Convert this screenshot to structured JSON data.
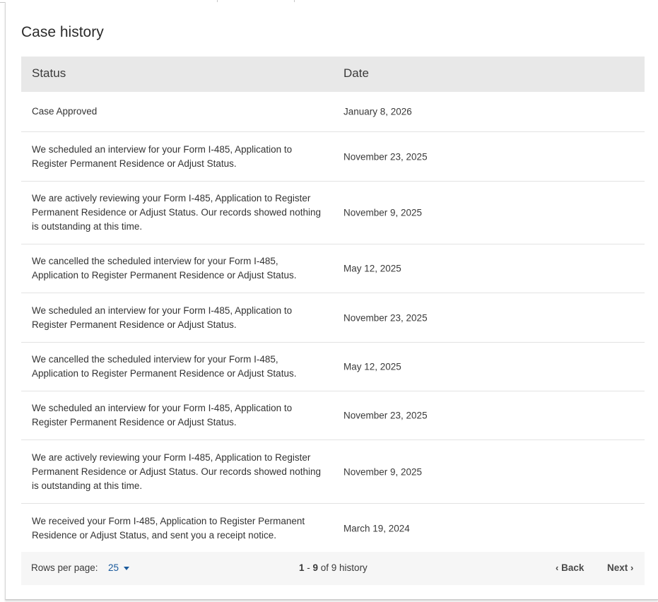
{
  "card": {
    "title": "Case history"
  },
  "table": {
    "headers": {
      "status": "Status",
      "date": "Date"
    },
    "rows": [
      {
        "status": "Case Approved",
        "date": "January 8, 2026"
      },
      {
        "status": "We scheduled an interview for your Form I-485, Application to Register Permanent Residence or Adjust Status.",
        "date": "November 23, 2025"
      },
      {
        "status": "We are actively reviewing your Form I-485, Application to Register Permanent Residence or Adjust Status. Our records showed nothing is outstanding at this time.",
        "date": "November 9, 2025"
      },
      {
        "status": "We cancelled the scheduled interview for your Form I-485, Application to Register Permanent Residence or Adjust Status.",
        "date": "May 12, 2025"
      },
      {
        "status": "We scheduled an interview for your Form I-485, Application to Register Permanent Residence or Adjust Status.",
        "date": "November 23, 2025"
      },
      {
        "status": "We cancelled the scheduled interview for your Form I-485, Application to Register Permanent Residence or Adjust Status.",
        "date": "May 12, 2025"
      },
      {
        "status": "We scheduled an interview for your Form I-485, Application to Register Permanent Residence or Adjust Status.",
        "date": "November 23, 2025"
      },
      {
        "status": "We are actively reviewing your Form I-485, Application to Register Permanent Residence or Adjust Status. Our records showed nothing is outstanding at this time.",
        "date": "November 9, 2025"
      },
      {
        "status": "We received your Form I-485, Application to Register Permanent Residence or Adjust Status, and sent you a receipt notice.",
        "date": "March 19, 2024"
      }
    ]
  },
  "pagination": {
    "rows_per_page_label": "Rows per page:",
    "rows_per_page_value": "25",
    "range_start": "1",
    "range_sep": " - ",
    "range_end": "9",
    "range_suffix": " of 9 history",
    "back_label": "Back",
    "next_label": "Next"
  },
  "icons": {
    "dropdown": "caret-down-icon",
    "back": "chevron-left-icon",
    "next": "chevron-right-icon"
  },
  "colors": {
    "header_bg": "#e8e8e8",
    "footer_bg": "#f6f6f6",
    "link": "#1a5a9c"
  }
}
